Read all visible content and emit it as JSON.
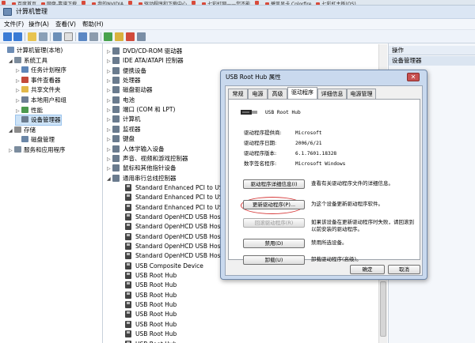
{
  "browser_tabs": [
    "",
    "百度首页",
    "网盘-靠谱下载",
    "",
    "我的NVIDIA",
    "",
    "驱动程序和下载中心",
    "",
    "七彩虹网——您不能",
    "",
    "碧风显卡 Colorfire",
    "七彩虹主板(OS)"
  ],
  "window": {
    "title": "计算机管理"
  },
  "menu": [
    "文件(F)",
    "操作(A)",
    "查看(V)",
    "帮助(H)"
  ],
  "left_tree": [
    {
      "label": "计算机管理(本地)",
      "indent": 0,
      "arrow": ""
    },
    {
      "label": "系统工具",
      "indent": 1,
      "arrow": "◢"
    },
    {
      "label": "任务计划程序",
      "indent": 2,
      "arrow": "▷"
    },
    {
      "label": "事件查看器",
      "indent": 2,
      "arrow": "▷"
    },
    {
      "label": "共享文件夹",
      "indent": 2,
      "arrow": "▷"
    },
    {
      "label": "本地用户和组",
      "indent": 2,
      "arrow": "▷"
    },
    {
      "label": "性能",
      "indent": 2,
      "arrow": "▷"
    },
    {
      "label": "设备管理器",
      "indent": 2,
      "arrow": "",
      "selected": true
    },
    {
      "label": "存储",
      "indent": 1,
      "arrow": "◢"
    },
    {
      "label": "磁盘管理",
      "indent": 2,
      "arrow": ""
    },
    {
      "label": "服务和应用程序",
      "indent": 1,
      "arrow": "▷"
    }
  ],
  "device_tree": [
    {
      "label": "DVD/CD-ROM 驱动器",
      "indent": 0,
      "arrow": "▷"
    },
    {
      "label": "IDE ATA/ATAPI 控制器",
      "indent": 0,
      "arrow": "▷"
    },
    {
      "label": "便携设备",
      "indent": 0,
      "arrow": "▷"
    },
    {
      "label": "处理器",
      "indent": 0,
      "arrow": "▷"
    },
    {
      "label": "磁盘驱动器",
      "indent": 0,
      "arrow": "▷"
    },
    {
      "label": "电池",
      "indent": 0,
      "arrow": "▷"
    },
    {
      "label": "端口 (COM 和 LPT)",
      "indent": 0,
      "arrow": "▷"
    },
    {
      "label": "计算机",
      "indent": 0,
      "arrow": "▷"
    },
    {
      "label": "监视器",
      "indent": 0,
      "arrow": "▷"
    },
    {
      "label": "键盘",
      "indent": 0,
      "arrow": "▷"
    },
    {
      "label": "人体学输入设备",
      "indent": 0,
      "arrow": "▷"
    },
    {
      "label": "声音、视频和游戏控制器",
      "indent": 0,
      "arrow": "▷"
    },
    {
      "label": "鼠标和其他指针设备",
      "indent": 0,
      "arrow": "▷"
    },
    {
      "label": "通用串行总线控制器",
      "indent": 0,
      "arrow": "◢"
    },
    {
      "label": "Standard Enhanced PCI to USB",
      "indent": 1,
      "arrow": ""
    },
    {
      "label": "Standard Enhanced PCI to USB",
      "indent": 1,
      "arrow": ""
    },
    {
      "label": "Standard Enhanced PCI to USB",
      "indent": 1,
      "arrow": ""
    },
    {
      "label": "Standard OpenHCD USB Host",
      "indent": 1,
      "arrow": ""
    },
    {
      "label": "Standard OpenHCD USB Host",
      "indent": 1,
      "arrow": ""
    },
    {
      "label": "Standard OpenHCD USB Host",
      "indent": 1,
      "arrow": ""
    },
    {
      "label": "Standard OpenHCD USB Host",
      "indent": 1,
      "arrow": ""
    },
    {
      "label": "Standard OpenHCD USB Host",
      "indent": 1,
      "arrow": ""
    },
    {
      "label": "USB Composite Device",
      "indent": 1,
      "arrow": ""
    },
    {
      "label": "USB Root Hub",
      "indent": 1,
      "arrow": ""
    },
    {
      "label": "USB Root Hub",
      "indent": 1,
      "arrow": ""
    },
    {
      "label": "USB Root Hub",
      "indent": 1,
      "arrow": ""
    },
    {
      "label": "USB Root Hub",
      "indent": 1,
      "arrow": ""
    },
    {
      "label": "USB Root Hub",
      "indent": 1,
      "arrow": ""
    },
    {
      "label": "USB Root Hub",
      "indent": 1,
      "arrow": ""
    },
    {
      "label": "USB Root Hub",
      "indent": 1,
      "arrow": ""
    },
    {
      "label": "USB Root Hub",
      "indent": 1,
      "arrow": ""
    },
    {
      "label": "网络适配器",
      "indent": 0,
      "arrow": "▷"
    }
  ],
  "actions": {
    "header": "操作",
    "sub": "设备管理器"
  },
  "dialog": {
    "title": "USB Root Hub 属性",
    "close": "✕",
    "tabs": [
      "常规",
      "电源",
      "高级",
      "驱动程序",
      "详细信息",
      "电源管理"
    ],
    "active_tab": 3,
    "device_name": "USB Root Hub",
    "fields": [
      {
        "label": "驱动程序提供商:",
        "value": "Microsoft"
      },
      {
        "label": "驱动程序日期:",
        "value": "2006/6/21"
      },
      {
        "label": "驱动程序版本:",
        "value": "6.1.7601.18328"
      },
      {
        "label": "数字签名程序:",
        "value": "Microsoft Windows"
      }
    ],
    "buttons": [
      {
        "label": "驱动程序详细信息(I)",
        "desc": "查看有关驱动程序文件的详细信息。",
        "disabled": false
      },
      {
        "label": "更新驱动程序(P)...",
        "desc": "为这个设备更新驱动程序软件。",
        "disabled": false
      },
      {
        "label": "回滚驱动程序(R)",
        "desc": "如果该设备在更新驱动程序时失败，请回滚到以前安装的驱动程序。",
        "disabled": true
      },
      {
        "label": "禁用(D)",
        "desc": "禁用所选设备。",
        "disabled": false
      },
      {
        "label": "卸载(U)",
        "desc": "卸载驱动程序(高级)。",
        "disabled": false
      }
    ],
    "ok": "确定",
    "cancel": "取消"
  },
  "colors": {
    "selection": "#cde3f7",
    "dialog_frame": "#c9d9ee",
    "highlight": "#d63a3a"
  }
}
